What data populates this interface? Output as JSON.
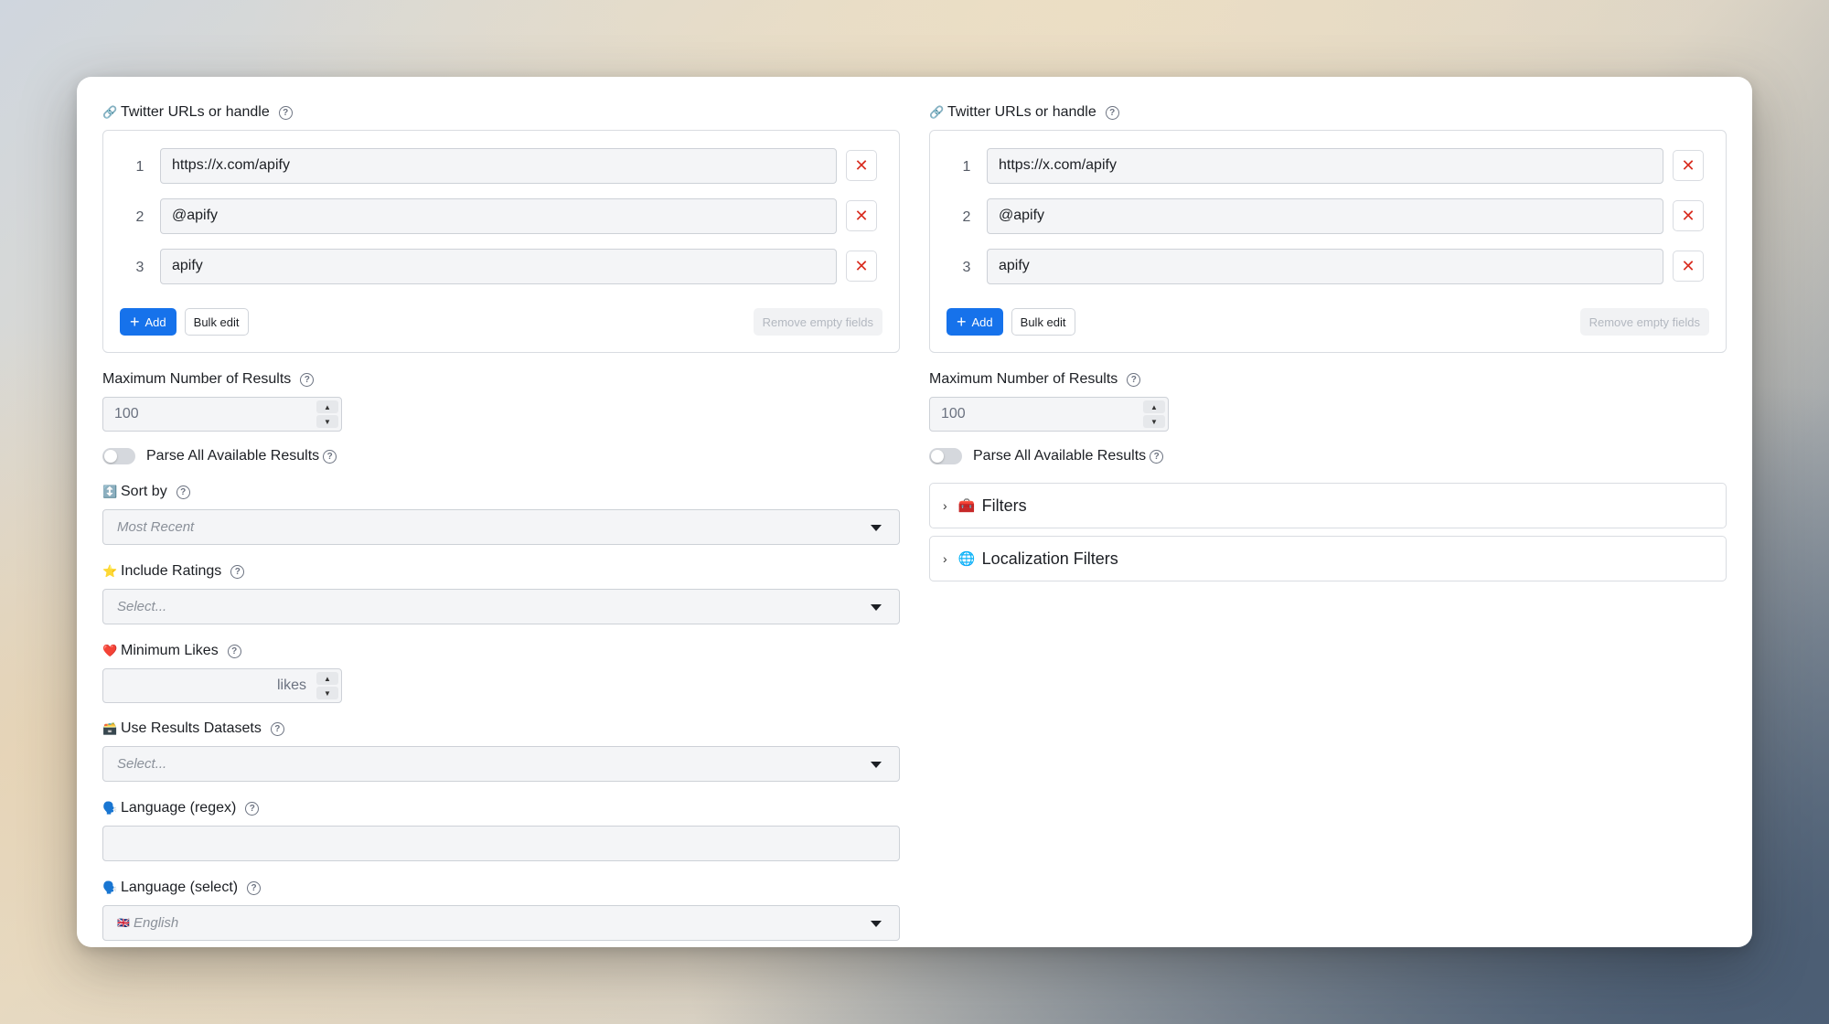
{
  "left": {
    "urls": {
      "label": "Twitter URLs or handle",
      "icon": "link-icon",
      "items": [
        {
          "num": "1",
          "value": "https://x.com/apify"
        },
        {
          "num": "2",
          "value": "@apify"
        },
        {
          "num": "3",
          "value": "apify"
        }
      ],
      "add_label": "Add",
      "bulk_label": "Bulk edit",
      "remove_label": "Remove empty fields"
    },
    "max_results": {
      "label": "Maximum Number of Results",
      "value": "100"
    },
    "parse_all": {
      "label": "Parse All Available Results"
    },
    "sort_by": {
      "label": "Sort by",
      "emoji": "↕️",
      "value": "Most Recent"
    },
    "include_ratings": {
      "label": "Include Ratings",
      "emoji": "⭐",
      "value": "Select..."
    },
    "min_likes": {
      "label": "Minimum Likes",
      "emoji": "❤️",
      "unit": "likes"
    },
    "use_datasets": {
      "label": "Use Results Datasets",
      "emoji": "🗃️",
      "value": "Select..."
    },
    "language_regex": {
      "label": "Language (regex)",
      "emoji": "🗣️"
    },
    "language_select": {
      "label": "Language (select)",
      "emoji": "🗣️",
      "flag": "🇬🇧",
      "value": "English"
    }
  },
  "right": {
    "urls": {
      "label": "Twitter URLs or handle",
      "icon": "link-icon",
      "items": [
        {
          "num": "1",
          "value": "https://x.com/apify"
        },
        {
          "num": "2",
          "value": "@apify"
        },
        {
          "num": "3",
          "value": "apify"
        }
      ],
      "add_label": "Add",
      "bulk_label": "Bulk edit",
      "remove_label": "Remove empty fields"
    },
    "max_results": {
      "label": "Maximum Number of Results",
      "value": "100"
    },
    "parse_all": {
      "label": "Parse All Available Results"
    },
    "filters": {
      "label": "Filters",
      "emoji": "🧰"
    },
    "localization": {
      "label": "Localization Filters",
      "emoji": "🌐"
    }
  },
  "icons": {
    "help": "?",
    "delete": "✕",
    "plus": "+",
    "chevron": "›",
    "link": "🔗"
  }
}
